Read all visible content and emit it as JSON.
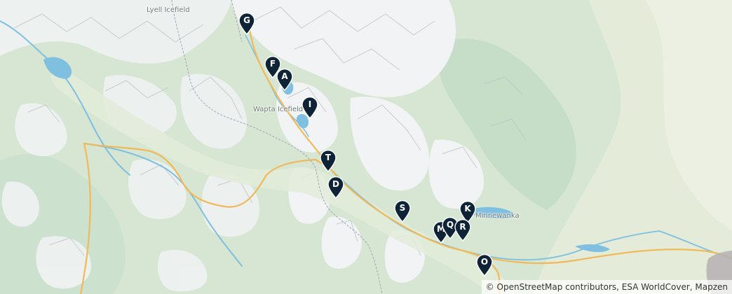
{
  "colors": {
    "land": "#d6e6d2",
    "forest": "#c3dcc6",
    "lowland": "#e8efdf",
    "rock": "#eef1f1",
    "ridge": "#b9c1c4",
    "water": "#7fbfdf",
    "road": "#f0b95a",
    "boundary": "#a79fb6",
    "marker": "#0f2337",
    "urban": "#b7b4b4"
  },
  "labels": {
    "lyell": "Lyell Icefield",
    "wapta": "Wapta Icefield",
    "minnewanka": "Minnewanka"
  },
  "markers": [
    "G",
    "F",
    "A",
    "I",
    "T",
    "D",
    "S",
    "K",
    "M",
    "Q",
    "R",
    "O"
  ],
  "attribution": {
    "prefix": "©",
    "text": "OpenStreetMap contributors, ESA WorldCover, Mapzen"
  }
}
